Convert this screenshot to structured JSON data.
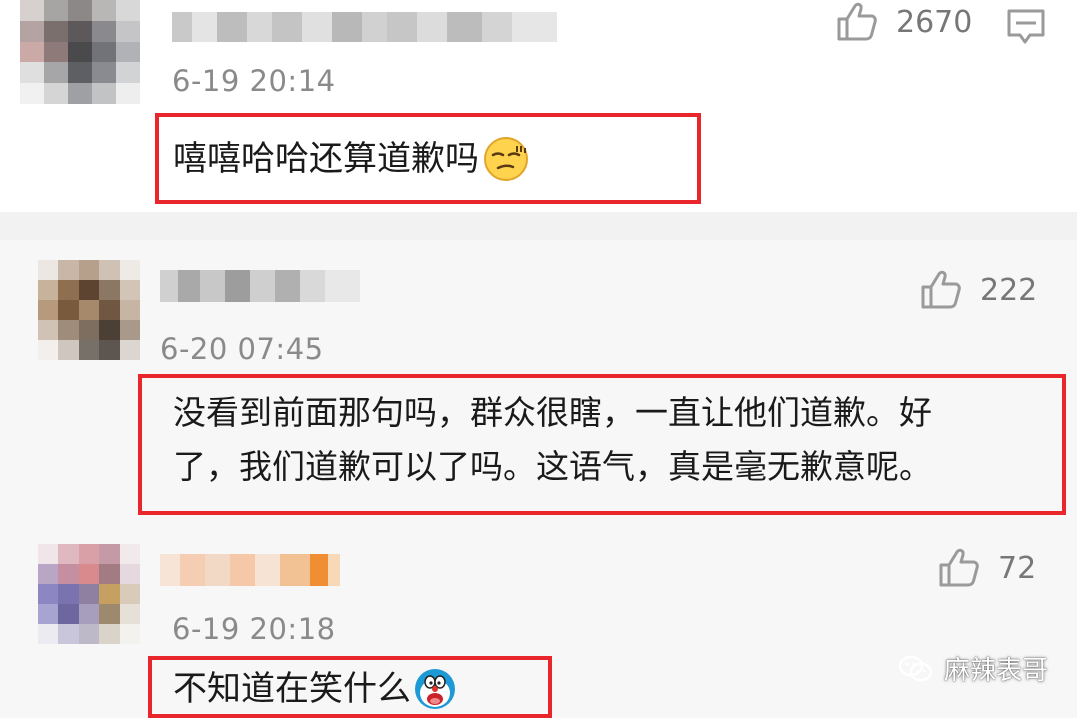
{
  "comments": [
    {
      "time": "6-19 20:14",
      "likes": "2670",
      "text": "嘻嘻哈哈还算道歉吗",
      "emoji": "smirk-emoji"
    },
    {
      "time": "6-20 07:45",
      "likes": "222",
      "text_line1": "没看到前面那句吗，群众很瞎，一直让他们道歉。好",
      "text_line2": "了，我们道歉可以了吗。这语气，真是毫无歉意呢。"
    },
    {
      "time": "6-19 20:18",
      "likes": "72",
      "text": "不知道在笑什么",
      "emoji": "doraemon-emoji"
    }
  ],
  "watermark": {
    "text": "麻辣表哥",
    "icon": "wechat-icon"
  },
  "colors": {
    "highlight": "#e8262b",
    "meta_text": "#8a8a8a",
    "divider": "#f2f2f2",
    "card_bg": "#f7f7f7"
  }
}
